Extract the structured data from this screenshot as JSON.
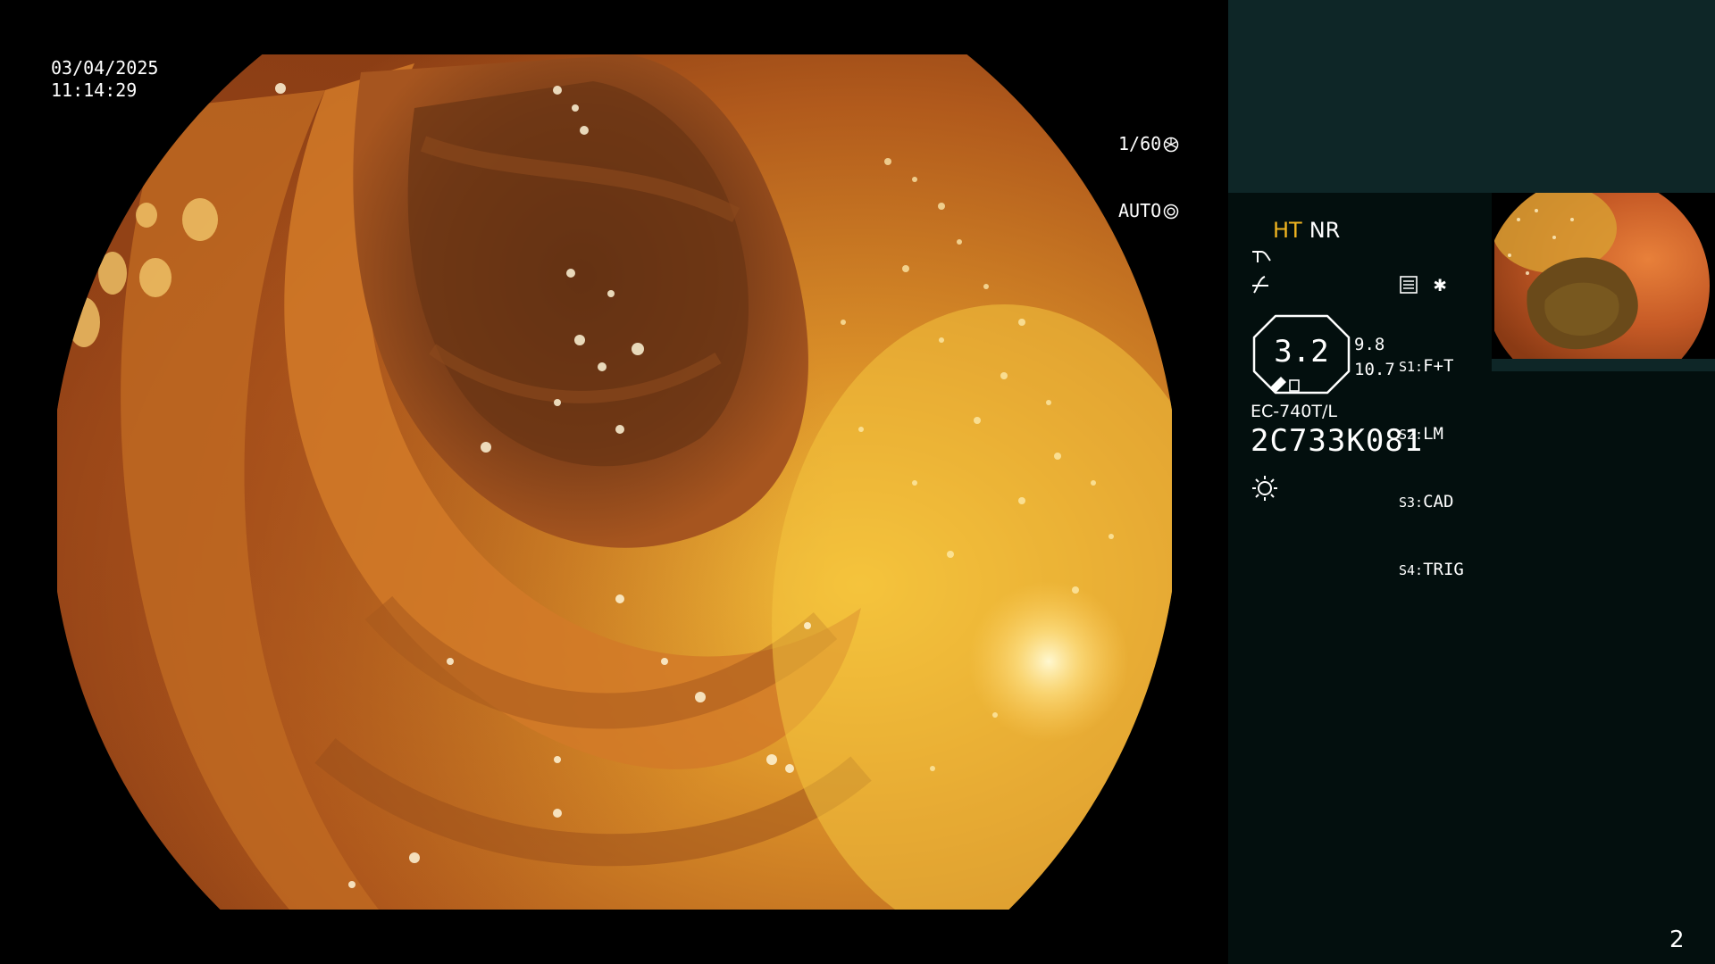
{
  "overlay": {
    "date": "03/04/2025",
    "time": "11:14:29",
    "shutter_speed": "1/60",
    "exposure_mode": "AUTO"
  },
  "panel": {
    "mode_ht": "HT",
    "mode_nr": "NR",
    "gauge_value": "3.2",
    "gauge_side_top": "9.8",
    "gauge_side_bottom": "10.7",
    "scenes": [
      {
        "key": "S1:",
        "value": "F+T"
      },
      {
        "key": "S2:",
        "value": "LM"
      },
      {
        "key": "S3:",
        "value": "CAD"
      },
      {
        "key": "S4:",
        "value": "TRIG"
      }
    ],
    "extra_symbol": "✱",
    "scope_model": "EC-740T/L",
    "scope_serial": "2C733K081",
    "page_number": "2"
  },
  "colors": {
    "panel_bg": "#030f0e",
    "panel_top": "#0e2627",
    "ht_accent": "#f0b420"
  },
  "icons": [
    "shutter-icon",
    "auto-exposure-icon",
    "curve-icon",
    "enhance-icon",
    "menu-icon",
    "brightness-icon"
  ]
}
